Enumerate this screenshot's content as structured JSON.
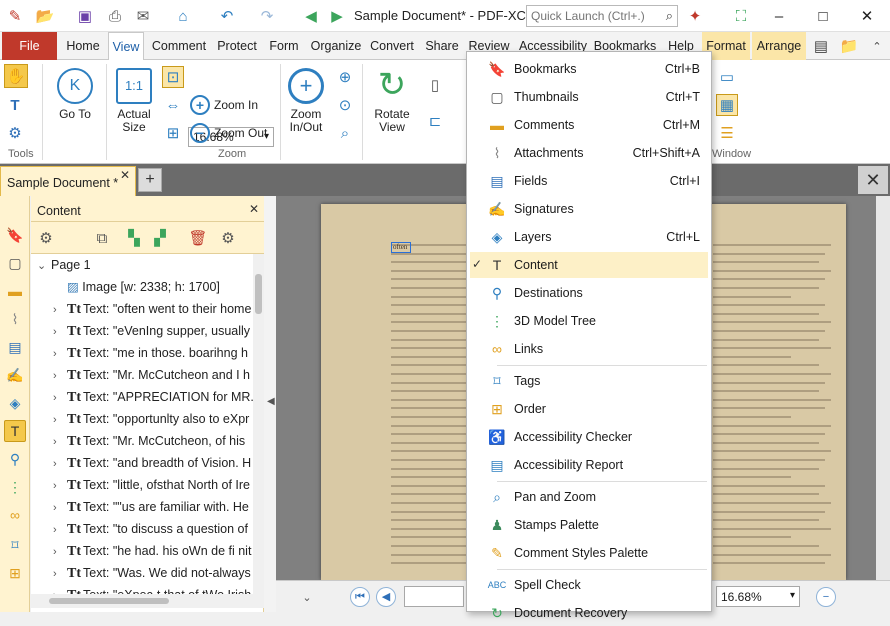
{
  "titlebar": {
    "doc_title": "Sample Document* - PDF-XCh...",
    "quick_launch_placeholder": "Quick Launch (Ctrl+.)"
  },
  "ribbon_tabs": [
    "File",
    "Home",
    "View",
    "Comment",
    "Protect",
    "Form",
    "Organize",
    "Convert",
    "Share",
    "Review",
    "Accessibility",
    "Bookmarks",
    "Help",
    "Format",
    "Arrange"
  ],
  "ribbon": {
    "tools_label": "Tools",
    "zoom_label": "Zoom",
    "window_label": "Window",
    "go_to": "Go To",
    "actual_size": "Actual Size",
    "zoom_value": "16.68%",
    "zoom_in": "Zoom In",
    "zoom_out": "Zoom Out",
    "zoom_in_out": "Zoom In/Out",
    "rotate_view": "Rotate View"
  },
  "doc_tab": {
    "title": "Sample Document *"
  },
  "content_panel": {
    "title": "Content",
    "tree": [
      {
        "label": "Page 1",
        "kind": "page"
      },
      {
        "label": "Image [w: 2338; h: 1700]",
        "kind": "image"
      },
      {
        "label": "Text: \"often went to their home",
        "kind": "text"
      },
      {
        "label": "Text: \"eVenIng supper, usually",
        "kind": "text"
      },
      {
        "label": "Text: \"me in those. boarihng h",
        "kind": "text"
      },
      {
        "label": "Text: \"Mr. McCutcheon and I h",
        "kind": "text"
      },
      {
        "label": "Text: \"APPRECIATION for MR. M",
        "kind": "text"
      },
      {
        "label": "Text: \"opportunlty also to eXpr",
        "kind": "text"
      },
      {
        "label": "Text: \"Mr. McCutcheon, of his",
        "kind": "text"
      },
      {
        "label": "Text: \"and breadth of Vision. H",
        "kind": "text"
      },
      {
        "label": "Text: \"little, ofsthat North of Ire",
        "kind": "text"
      },
      {
        "label": "Text: \"\"us are familiar with. He",
        "kind": "text"
      },
      {
        "label": "Text: \"to discuss a question of",
        "kind": "text"
      },
      {
        "label": "Text: \"he had. his oWn de fi nit",
        "kind": "text"
      },
      {
        "label": "Text: \"Was. We did not-always",
        "kind": "text"
      },
      {
        "label": "Text: \"eXpec-t that of tWo Irish",
        "kind": "text"
      }
    ]
  },
  "page": {
    "highlight_word": "often"
  },
  "statusbar": {
    "zoom": "16.68%"
  },
  "menu": {
    "items": [
      {
        "label": "Bookmarks",
        "shortcut": "Ctrl+B",
        "icon": "bookmark-icon",
        "checked": false
      },
      {
        "label": "Thumbnails",
        "shortcut": "Ctrl+T",
        "icon": "thumbnails-icon",
        "checked": false
      },
      {
        "label": "Comments",
        "shortcut": "Ctrl+M",
        "icon": "comment-icon",
        "checked": false
      },
      {
        "label": "Attachments",
        "shortcut": "Ctrl+Shift+A",
        "icon": "paperclip-icon",
        "checked": false
      },
      {
        "label": "Fields",
        "shortcut": "Ctrl+I",
        "icon": "fields-icon",
        "checked": false
      },
      {
        "label": "Signatures",
        "shortcut": "",
        "icon": "signature-icon",
        "checked": false
      },
      {
        "label": "Layers",
        "shortcut": "Ctrl+L",
        "icon": "layers-icon",
        "checked": false
      },
      {
        "label": "Content",
        "shortcut": "",
        "icon": "content-icon",
        "checked": true
      },
      {
        "label": "Destinations",
        "shortcut": "",
        "icon": "destination-icon",
        "checked": false
      },
      {
        "label": "3D Model Tree",
        "shortcut": "",
        "icon": "model-tree-icon",
        "checked": false
      },
      {
        "label": "Links",
        "shortcut": "",
        "icon": "link-icon",
        "checked": false
      },
      {
        "label": "Tags",
        "shortcut": "",
        "icon": "tag-icon",
        "checked": false
      },
      {
        "label": "Order",
        "shortcut": "",
        "icon": "order-icon",
        "checked": false
      },
      {
        "label": "Accessibility Checker",
        "shortcut": "",
        "icon": "accessibility-checker-icon",
        "checked": false
      },
      {
        "label": "Accessibility Report",
        "shortcut": "",
        "icon": "accessibility-report-icon",
        "checked": false
      },
      {
        "label": "Pan and Zoom",
        "shortcut": "",
        "icon": "pan-zoom-icon",
        "checked": false
      },
      {
        "label": "Stamps Palette",
        "shortcut": "",
        "icon": "stamp-icon",
        "checked": false
      },
      {
        "label": "Comment Styles Palette",
        "shortcut": "",
        "icon": "comment-styles-icon",
        "checked": false
      },
      {
        "label": "Spell Check",
        "shortcut": "",
        "icon": "spell-check-icon",
        "checked": false
      },
      {
        "label": "Document Recovery",
        "shortcut": "",
        "icon": "recovery-icon",
        "checked": false
      }
    ]
  }
}
